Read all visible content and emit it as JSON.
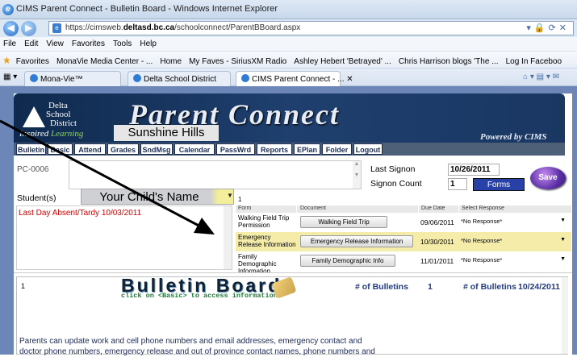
{
  "browser": {
    "title": "CIMS Parent Connect - Bulletin Board - Windows Internet Explorer",
    "url_prefix": "https://cimsweb.",
    "url_domain": "deltasd.bc.ca",
    "url_path": "/schoolconnect/ParentBBoard.aspx",
    "menu": [
      "File",
      "Edit",
      "View",
      "Favorites",
      "Tools",
      "Help"
    ],
    "favorites_label": "Favorites",
    "favorites": [
      "MonaVie Media Center - ...",
      "Home",
      "My Faves - SiriusXM Radio",
      "Ashley Hebert 'Betrayed' ...",
      "Chris Harrison blogs 'The ...",
      "Log In  Faceboo"
    ],
    "tabs": [
      "Mona-Vie™",
      "Delta School District",
      "CIMS Parent Connect - ..."
    ]
  },
  "app": {
    "logo_lines": [
      "Delta",
      "School",
      "District"
    ],
    "logo_tagline_a": "Inspired ",
    "logo_tagline_b": "Learning",
    "title": "Parent Connect",
    "school_name": "Sunshine Hills",
    "powered_by": "Powered by CIMS",
    "nav": [
      "Bulletin",
      "Basic",
      "Attend",
      "Grades",
      "SndMsg",
      "Calendar",
      "PassWrd",
      "Reports",
      "EPlan",
      "Folder",
      "Logout"
    ]
  },
  "summary": {
    "pc_id": "PC-0006",
    "signon_label": "Last Signon",
    "signon_date": "10/26/2011",
    "count_label": "Signon Count",
    "count_value": "1",
    "forms_history": "Forms History",
    "save_label": "Save",
    "students_label": "Student(s)",
    "student_name": "Your Child's Name",
    "absent_text": "Last Day Absent/Tardy 10/03/2011"
  },
  "forms": {
    "count": "1",
    "headers": [
      "Form",
      "Document",
      "Due Date",
      "Select Response"
    ],
    "rows": [
      {
        "form": "Walking Field Trip Permission",
        "document": "Walking Field Trip",
        "due": "09/06/2011",
        "response": "*No Response*"
      },
      {
        "form": "Emergency Release Information",
        "document": "Emergency Release Information",
        "due": "10/30/2011",
        "response": "*No Response*"
      },
      {
        "form": "Family Demographic Information",
        "document": "Family Demographic Info",
        "due": "11/01/2011",
        "response": "*No Response*"
      }
    ]
  },
  "bulletin": {
    "number": "1",
    "title": "Bulletin Board",
    "subtitle": "click on <Basic> to access information",
    "count_label_1": "# of Bulletins",
    "count_value_1": "1",
    "count_label_2": "# of Bulletins",
    "count_value_2": "10/24/2011",
    "text_line1": "Parents can update work and cell phone numbers and email addresses, emergency contact and",
    "text_line2": "doctor phone numbers, emergency release and out of province contact names, phone numbers and"
  }
}
